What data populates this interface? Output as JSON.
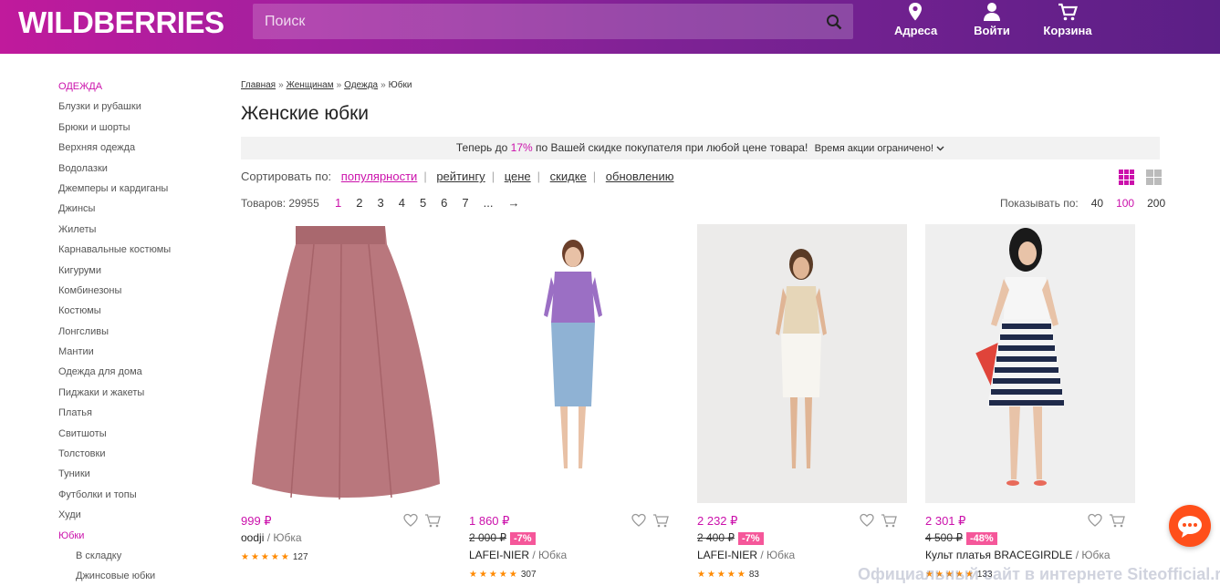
{
  "header": {
    "logo": "WILDBERRIES",
    "search_placeholder": "Поиск",
    "buttons": [
      {
        "label": "Адреса",
        "icon": "map-pin-icon"
      },
      {
        "label": "Войти",
        "icon": "user-icon"
      },
      {
        "label": "Корзина",
        "icon": "cart-icon"
      }
    ]
  },
  "sidebar": {
    "heading": "ОДЕЖДА",
    "items": [
      "Блузки и рубашки",
      "Брюки и шорты",
      "Верхняя одежда",
      "Водолазки",
      "Джемперы и кардиганы",
      "Джинсы",
      "Жилеты",
      "Карнавальные костюмы",
      "Кигуруми",
      "Комбинезоны",
      "Костюмы",
      "Лонгсливы",
      "Мантии",
      "Одежда для дома",
      "Пиджаки и жакеты",
      "Платья",
      "Свитшоты",
      "Толстовки",
      "Туники",
      "Футболки и топы",
      "Худи"
    ],
    "active_item": "Юбки",
    "sub_items": [
      "В складку",
      "Джинсовые юбки"
    ]
  },
  "breadcrumb": [
    "Главная",
    "Женщинам",
    "Одежда",
    "Юбки"
  ],
  "title": "Женские юбки",
  "promo": {
    "before": "Теперь до ",
    "percent": "17%",
    "after": " по Вашей скидке покупателя при любой цене товара!",
    "limited": "Время акции ограничено!"
  },
  "sort": {
    "label": "Сортировать по:",
    "options": [
      "популярности",
      "рейтингу",
      "цене",
      "скидке",
      "обновлению"
    ],
    "active": "популярности"
  },
  "listing": {
    "count_label": "Товаров: 29955",
    "pages": [
      "1",
      "2",
      "3",
      "4",
      "5",
      "6",
      "7",
      "...",
      "→"
    ],
    "current_page": "1",
    "perpage_label": "Показывать по:",
    "perpage_options": [
      "40",
      "100",
      "200"
    ],
    "perpage_current": "100"
  },
  "products": [
    {
      "price": "999 ₽",
      "old_price": "",
      "discount": "",
      "brand": "oodji",
      "type": "Юбка",
      "stars": "★★★★★",
      "reviews": "127",
      "bg": "#ffffff",
      "garment": "#b9777d"
    },
    {
      "price": "1 860 ₽",
      "old_price": "2 000 ₽",
      "discount": "-7%",
      "brand": "LAFEI-NIER",
      "type": "Юбка",
      "stars": "★★★★★",
      "reviews": "307",
      "bg": "#ffffff",
      "garment": "#8fb2d4"
    },
    {
      "price": "2 232 ₽",
      "old_price": "2 400 ₽",
      "discount": "-7%",
      "brand": "LAFEI-NIER",
      "type": "Юбка",
      "stars": "★★★★★",
      "reviews": "83",
      "bg": "#ecebea",
      "garment": "#f2efe9"
    },
    {
      "price": "2 301 ₽",
      "old_price": "4 500 ₽",
      "discount": "-48%",
      "brand": "Культ платья BRACEGIRDLE",
      "type": "Юбка",
      "stars": "★★★★★",
      "reviews": "133",
      "bg": "#efefef",
      "garment": "#1f2a4a"
    }
  ],
  "watermark": "Официальный сайт в интернете Siteofficial.ru"
}
